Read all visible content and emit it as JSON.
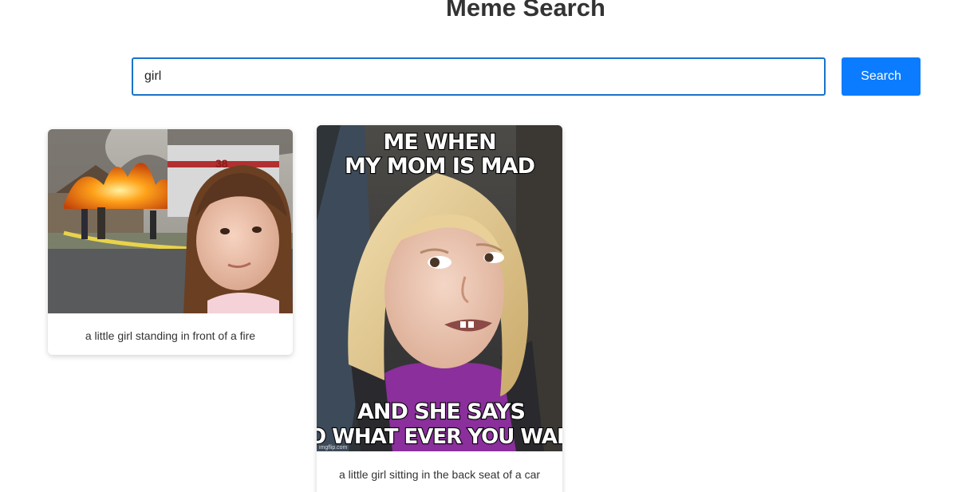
{
  "header": {
    "title": "Meme Search"
  },
  "search": {
    "value": "girl",
    "button_label": "Search"
  },
  "results": [
    {
      "caption": "a little girl standing in front of a fire"
    },
    {
      "caption": "a little girl sitting in the back seat of a car",
      "meme_top_line_1": "ME WHEN",
      "meme_top_line_2": "MY MOM IS MAD",
      "meme_bottom_line_1": "AND SHE SAYS",
      "meme_bottom_line_2": "DO WHAT EVER YOU WANT",
      "watermark": "imgflip.com"
    }
  ],
  "colors": {
    "accent": "#0b7cff",
    "input_border": "#1a73c9",
    "title": "#333333"
  }
}
